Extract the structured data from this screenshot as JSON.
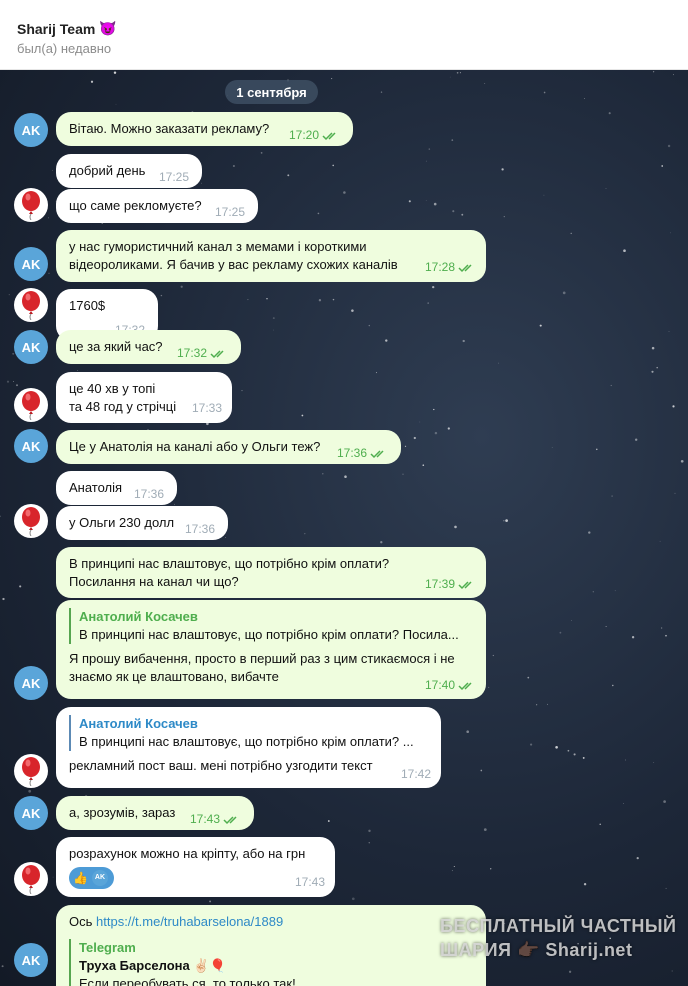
{
  "header": {
    "title": "Sharij Team",
    "title_emoji": "😈",
    "status": "был(а) недавно"
  },
  "chat": {
    "date": "1 сентября",
    "avatars": {
      "ak_initials": "AK",
      "other_icon": "red-balloon-icon"
    },
    "messages": [
      {
        "dir": "out",
        "text": "Вітаю. Можно заказати рекламу?",
        "time": "17:20"
      },
      {
        "dir": "in",
        "text": "добрий день",
        "time": "17:25"
      },
      {
        "dir": "in",
        "text": "що саме рекломуєте?",
        "time": "17:25"
      },
      {
        "dir": "out",
        "text": "у нас гумористичний канал з мемами і короткими\nвідеороликами. Я бачив у вас рекламу схожих каналів",
        "time": "17:28"
      },
      {
        "dir": "in",
        "text": "1760$",
        "time": "17:32"
      },
      {
        "dir": "out",
        "text": "це за який час?",
        "time": "17:32"
      },
      {
        "dir": "in",
        "text": "це 40 хв у топі\nта 48 год у стрічці",
        "time": "17:33"
      },
      {
        "dir": "out",
        "text": "Це у Анатолія на каналі або у Ольги теж?",
        "time": "17:36"
      },
      {
        "dir": "in",
        "text": "Анатолія",
        "time": "17:36"
      },
      {
        "dir": "in",
        "text": "у Ольги 230 долл",
        "time": "17:36"
      },
      {
        "dir": "out",
        "text": "В принципі нас влаштовує, що потрібно крім оплати?\nПосилання на канал чи що?",
        "time": "17:39"
      },
      {
        "dir": "out",
        "reply_author": "Анатолий Косачев",
        "reply_quote": "В принципі нас влаштовує, що потрібно крім оплати? Посила...",
        "text": "Я прошу вибачення, просто в перший раз з цим стикаємося і не\nзнаємо як це влаштовано, вибачте",
        "time": "17:40"
      },
      {
        "dir": "in",
        "reply_author": "Анатолий Косачев",
        "reply_quote": "В принципі нас влаштовує, що потрібно крім оплати? ...",
        "text": "рекламний пост ваш. мені потрібно узгодити текст",
        "time": "17:42"
      },
      {
        "dir": "out",
        "text": "а, зрозумів, зараз",
        "time": "17:43"
      },
      {
        "dir": "in",
        "text": "розрахунок можно на кріпту, або на грн",
        "time": "17:43",
        "reaction_emoji": "👍",
        "reaction_user": "AK"
      },
      {
        "dir": "out",
        "text_prefix": "Ось",
        "link": "https://t.me/truhabarselona/1889",
        "preview_source": "Telegram",
        "preview_title": "Труха Барселона",
        "preview_emoji": "✌🏻🎈",
        "preview_text": "Если переобувать ся, то только так!"
      }
    ]
  },
  "watermark": {
    "line1": "БЕСПЛАТНЫЙ ЧАСТНЫЙ",
    "line2_prefix": "ШАРИЯ",
    "line2_suffix": "Sharij.net"
  },
  "colors": {
    "outgoing_bubble": "#effdde",
    "incoming_bubble": "#ffffff",
    "time_out": "#4fae4e",
    "avatar_ak": "#5aa5d9",
    "link": "#2e8ac7"
  }
}
